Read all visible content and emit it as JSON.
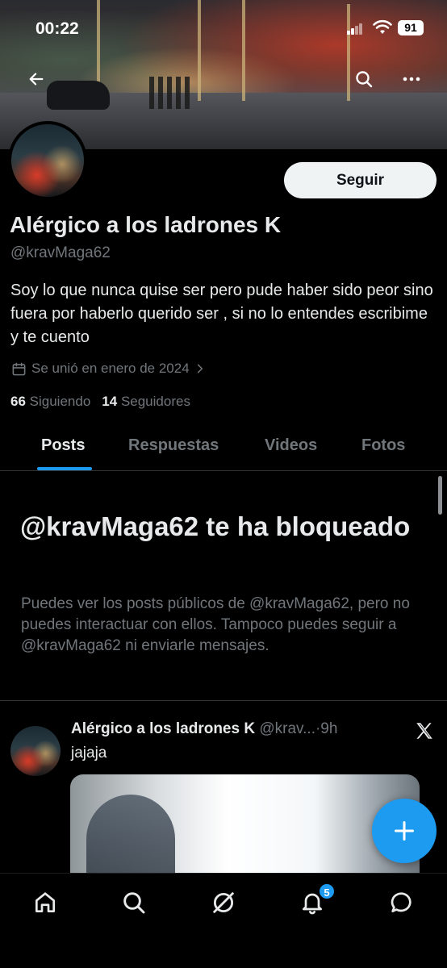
{
  "status_bar": {
    "time": "00:22",
    "battery": "91"
  },
  "profile": {
    "display_name": "Alérgico a los ladrones K",
    "handle": "@kravMaga62",
    "follow_label": "Seguir",
    "bio": "Soy lo que nunca quise ser pero pude haber sido peor sino fuera por haberlo querido ser , si no lo entendes escribime y te cuento",
    "joined": "Se unió en enero de 2024",
    "following_count": "66",
    "following_label": "Siguiendo",
    "followers_count": "14",
    "followers_label": "Seguidores"
  },
  "tabs": [
    {
      "label": "Posts",
      "active": true
    },
    {
      "label": "Respuestas",
      "active": false
    },
    {
      "label": "Videos",
      "active": false
    },
    {
      "label": "Fotos",
      "active": false
    }
  ],
  "blocked": {
    "title": "@kravMaga62 te ha bloqueado",
    "description": "Puedes ver los posts públicos de @kravMaga62, pero no puedes interactuar con ellos. Tampoco puedes seguir a @kravMaga62 ni enviarle mensajes."
  },
  "post": {
    "author_name": "Alérgico a los ladrones K",
    "author_handle": "@krav...",
    "separator": "·",
    "time": "9h",
    "text": "jajaja"
  },
  "bottom_nav": {
    "notifications_badge": "5"
  },
  "colors": {
    "accent": "#1d9bf0",
    "background": "#000000",
    "text": "#e7e9ea",
    "muted": "#71767b"
  },
  "icons": [
    "back-arrow-icon",
    "search-icon",
    "more-icon",
    "calendar-icon",
    "chevron-right-icon",
    "x-logo-icon",
    "compose-plus-icon",
    "home-icon",
    "explore-icon",
    "grok-icon",
    "bell-icon",
    "messages-icon"
  ]
}
